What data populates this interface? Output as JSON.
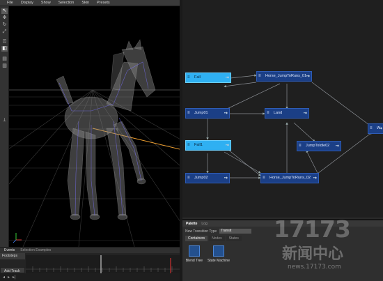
{
  "menu": [
    "File",
    "Display",
    "Show",
    "Selection",
    "Skin",
    "Presets"
  ],
  "tools": [
    "select-icon",
    "move-icon",
    "rotate-icon",
    "scale-icon",
    "lock-icon",
    "camera-icon",
    "film-icon",
    "layer-icon"
  ],
  "events": {
    "tabs": [
      "Events",
      "Selection Examples"
    ],
    "track_name": "Footsteps",
    "add_track": "Add Track"
  },
  "graph": {
    "nodes": [
      {
        "id": "fall",
        "label": "Fall",
        "selected": true
      },
      {
        "id": "h1",
        "label": "Horse_JumpToRuns_01",
        "selected": false
      },
      {
        "id": "jump01",
        "label": "Jump01",
        "selected": false
      },
      {
        "id": "land",
        "label": "Land",
        "selected": false
      },
      {
        "id": "fall1",
        "label": "Fall1",
        "selected": true
      },
      {
        "id": "jtidle",
        "label": "JumpToIdle02",
        "selected": false
      },
      {
        "id": "jump02",
        "label": "Jump02",
        "selected": false
      },
      {
        "id": "h2",
        "label": "Horse_JumpToRuns_02",
        "selected": false
      },
      {
        "id": "w",
        "label": "W",
        "selected": false
      }
    ]
  },
  "palette": {
    "tabs": [
      "Palette",
      "Log"
    ],
    "transition_label": "New Transition Type",
    "transition_value": "Transit",
    "subtabs": [
      "Containers",
      "Nodes",
      "States"
    ],
    "items": [
      "Blend Tree",
      "State Machine"
    ]
  },
  "watermark": {
    "logo": "17173",
    "cn": "新闻中心",
    "url": "news.17173.com"
  },
  "colors": {
    "node": "#1b3f86",
    "node_selected": "#2fb0f2",
    "accent_orange": "#f0a030"
  }
}
